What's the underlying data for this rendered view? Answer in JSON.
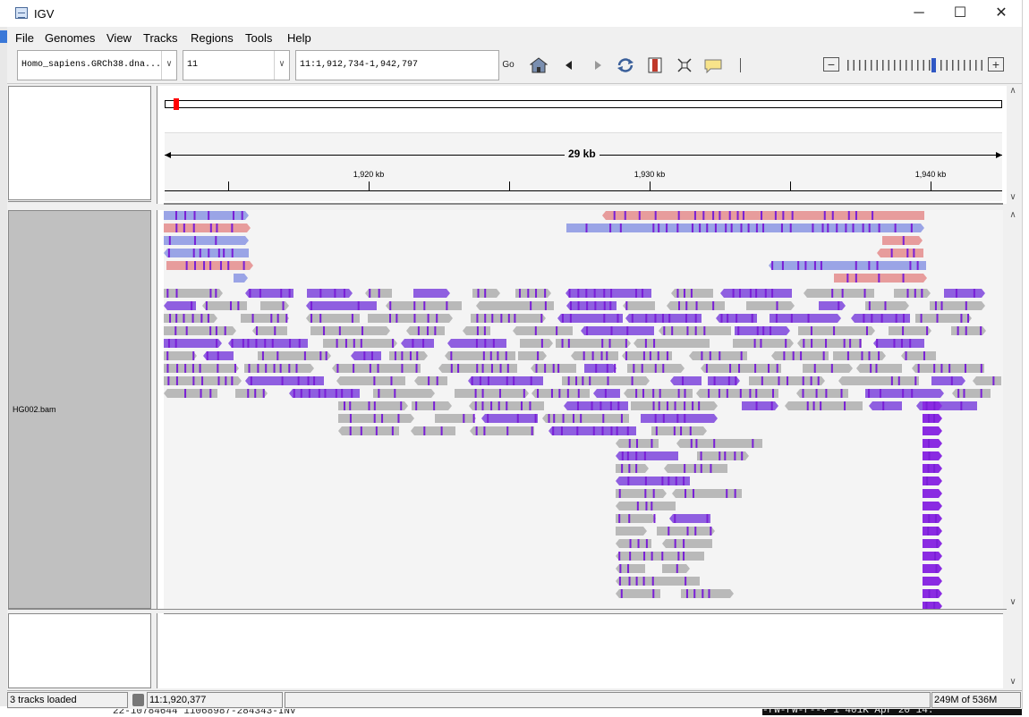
{
  "window": {
    "title": "IGV",
    "minimize": "─",
    "maximize": "☐",
    "close": "✕"
  },
  "menu": [
    "File",
    "Genomes",
    "View",
    "Tracks",
    "Regions",
    "Tools",
    "Help"
  ],
  "toolbar": {
    "genome": "Homo_sapiens.GRCh38.dna...",
    "chromosome": "11",
    "locus": "11:1,912,734-1,942,797",
    "go_label": "Go",
    "icons": [
      "home-icon",
      "back-icon",
      "forward-icon",
      "refresh-icon",
      "roi-icon",
      "resize-icon",
      "popup-info-icon",
      "zoom-out-icon",
      "zoom-in-icon"
    ]
  },
  "ruler": {
    "span_label": "29 kb",
    "tick_labels": [
      "1,920 kb",
      "1,930 kb",
      "1,940 kb"
    ]
  },
  "tracks": {
    "bam_name": "HG002.bam"
  },
  "status": {
    "tracks_loaded": "3 tracks loaded",
    "position": "11:1,920,377",
    "memory": "249M of 536M"
  },
  "background_text": {
    "bottom_left": "22-10784644 11068987-284343-INV",
    "bottom_right": "-rw-rw-r--+ 1 401K Apr 20 14:"
  },
  "colors": {
    "read_grey": "#b9b9b9",
    "read_purple": "#8a2be2",
    "read_blue": "#9aa4e6",
    "read_pink": "#e79c9c",
    "insertion": "#7a1fd6",
    "name_panel": "#c0c0c0",
    "chrom_marker": "#ff0000"
  }
}
